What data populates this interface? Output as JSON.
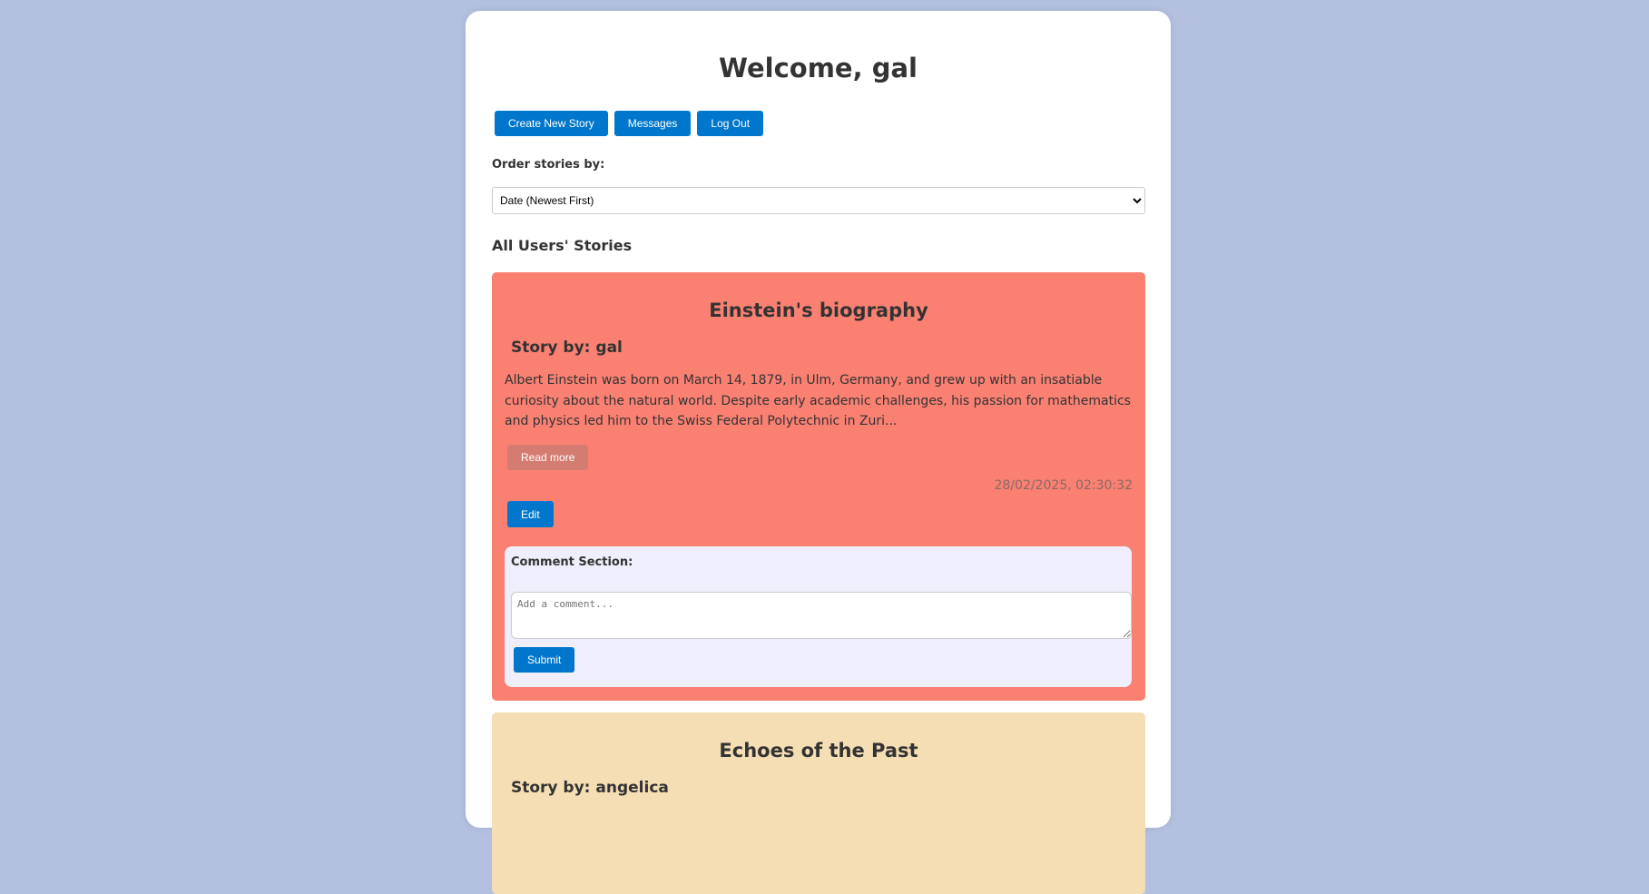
{
  "header": {
    "title": "Welcome, gal"
  },
  "toolbar": {
    "create": "Create New Story",
    "messages": "Messages",
    "logout": "Log Out"
  },
  "order": {
    "label": "Order stories by:",
    "selected": "Date (Newest First)"
  },
  "section_title": "All Users' Stories",
  "stories": [
    {
      "title": "Einstein's biography",
      "author": "Story by: gal",
      "excerpt": "Albert Einstein was born on March 14, 1879, in Ulm, Germany, and grew up with an insatiable curiosity about the natural world. Despite early academic challenges, his passion for mathematics and physics led him to the Swiss Federal Polytechnic in Zuri...",
      "read_more": "Read more",
      "date": "28/02/2025, 02:30:32",
      "edit": "Edit",
      "comments": {
        "title": "Comment Section:",
        "placeholder": "Add a comment...",
        "submit": "Submit"
      },
      "color": "#fa8072"
    },
    {
      "title": "Echoes of the Past",
      "author": "Story by: angelica",
      "color": "#f5deb3"
    }
  ]
}
